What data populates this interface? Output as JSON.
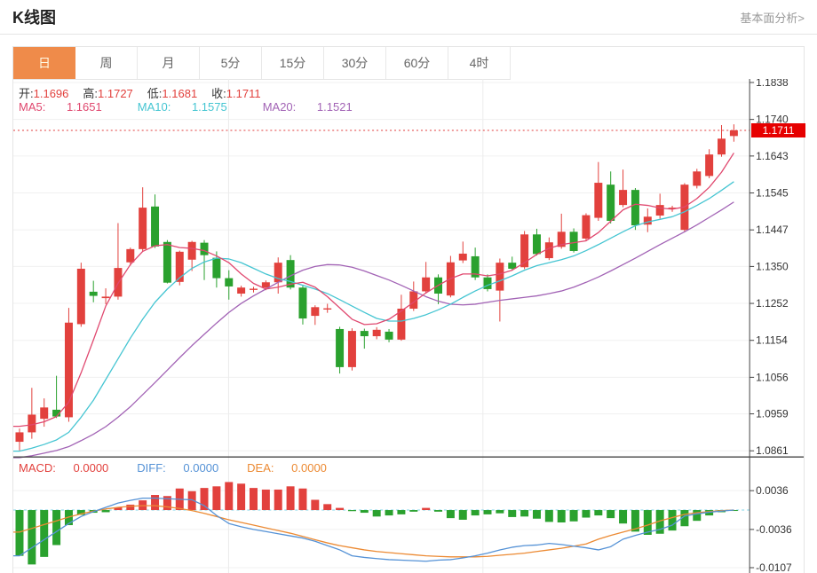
{
  "header": {
    "title": "K线图",
    "link": "基本面分析>"
  },
  "tabs": {
    "items": [
      "日",
      "周",
      "月",
      "5分",
      "15分",
      "30分",
      "60分",
      "4时"
    ],
    "active": "日"
  },
  "legend": {
    "ohlc": [
      {
        "label": "开:",
        "value": "1.1696"
      },
      {
        "label": "高:",
        "value": "1.1727"
      },
      {
        "label": "低:",
        "value": "1.1681"
      },
      {
        "label": "收:",
        "value": "1.1711"
      }
    ],
    "ma": [
      {
        "label": "MA5:",
        "value": "1.1651"
      },
      {
        "label": "MA10:",
        "value": "1.1575"
      },
      {
        "label": "MA20:",
        "value": "1.1521"
      }
    ],
    "macd": [
      {
        "label": "MACD:",
        "value": "0.0000"
      },
      {
        "label": "DIFF:",
        "value": "0.0000"
      },
      {
        "label": "DEA:",
        "value": "0.0000"
      }
    ]
  },
  "price_badge": "1.1711",
  "colors": {
    "up": "#e2413d",
    "down": "#2aa12e",
    "ma5": "#e0486f",
    "ma10": "#45c5d2",
    "ma20": "#a263b5",
    "diff": "#5592d6",
    "dea": "#ec8a33",
    "price_line": "#e03c3c",
    "zero_line": "#7fd4e8",
    "badge": "#e60000",
    "tab_active_bg": "#ef8b4a",
    "grid": "#f0f0f0",
    "vgrid": "#ececec",
    "axis": "#444"
  },
  "chart_data": {
    "type": "candlestick_with_macd",
    "title": "K线图",
    "legend_position": "topleft",
    "grid": true,
    "price_axis": {
      "ticks": [
        1.1838,
        1.174,
        1.1643,
        1.1545,
        1.1447,
        1.135,
        1.1252,
        1.1154,
        1.1056,
        1.0959,
        1.0861
      ],
      "range": [
        1.0838,
        1.1848
      ],
      "last_price": 1.1711
    },
    "macd_axis": {
      "ticks": [
        0.0036,
        -0.0036,
        -0.0107
      ],
      "range": [
        -0.0116,
        0.0093
      ],
      "zero": 0
    },
    "ohlc_current": {
      "open": 1.1696,
      "high": 1.1727,
      "low": 1.1681,
      "close": 1.1711
    },
    "ma_current": {
      "ma5": 1.1651,
      "ma10": 1.1575,
      "ma20": 1.1521
    },
    "macd_current": {
      "macd": 0.0,
      "diff": 0.0,
      "dea": 0.0
    },
    "candles": [
      [
        1.0885,
        1.092,
        1.0862,
        1.091
      ],
      [
        1.091,
        1.1028,
        1.0893,
        1.0957
      ],
      [
        1.0946,
        1.1,
        1.0925,
        1.0976
      ],
      [
        1.097,
        1.106,
        1.0948,
        1.0952
      ],
      [
        1.095,
        1.124,
        1.0938,
        1.1201
      ],
      [
        1.1197,
        1.136,
        1.119,
        1.1344
      ],
      [
        1.1283,
        1.1312,
        1.1255,
        1.1272
      ],
      [
        1.1266,
        1.1292,
        1.125,
        1.127
      ],
      [
        1.127,
        1.1465,
        1.1262,
        1.1346
      ],
      [
        1.1361,
        1.14,
        1.1352,
        1.1396
      ],
      [
        1.1396,
        1.156,
        1.139,
        1.1506
      ],
      [
        1.1509,
        1.1541,
        1.1399,
        1.1403
      ],
      [
        1.1415,
        1.142,
        1.1305,
        1.1307
      ],
      [
        1.1309,
        1.1392,
        1.13,
        1.1389
      ],
      [
        1.1368,
        1.1418,
        1.1338,
        1.1415
      ],
      [
        1.1413,
        1.142,
        1.1314,
        1.138
      ],
      [
        1.1373,
        1.139,
        1.1294,
        1.1319
      ],
      [
        1.1319,
        1.134,
        1.1262,
        1.1297
      ],
      [
        1.1278,
        1.1299,
        1.127,
        1.1294
      ],
      [
        1.1289,
        1.1296,
        1.1281,
        1.1291
      ],
      [
        1.1294,
        1.1313,
        1.1287,
        1.1308
      ],
      [
        1.1308,
        1.1374,
        1.1278,
        1.136
      ],
      [
        1.1367,
        1.138,
        1.1289,
        1.1294
      ],
      [
        1.1294,
        1.1299,
        1.1196,
        1.1212
      ],
      [
        1.1219,
        1.1247,
        1.1195,
        1.1242
      ],
      [
        1.1236,
        1.1251,
        1.1227,
        1.1239
      ],
      [
        1.1184,
        1.119,
        1.1066,
        1.1083
      ],
      [
        1.1083,
        1.1186,
        1.1074,
        1.1179
      ],
      [
        1.1179,
        1.1185,
        1.1132,
        1.1165
      ],
      [
        1.1165,
        1.1189,
        1.1157,
        1.1182
      ],
      [
        1.1177,
        1.1184,
        1.1149,
        1.1156
      ],
      [
        1.1156,
        1.1275,
        1.1153,
        1.1238
      ],
      [
        1.1238,
        1.131,
        1.1232,
        1.1284
      ],
      [
        1.1284,
        1.1362,
        1.1278,
        1.1321
      ],
      [
        1.1321,
        1.1329,
        1.125,
        1.1278
      ],
      [
        1.1273,
        1.1378,
        1.1268,
        1.1361
      ],
      [
        1.1366,
        1.1416,
        1.1359,
        1.1384
      ],
      [
        1.1377,
        1.14,
        1.1314,
        1.1321
      ],
      [
        1.1321,
        1.1329,
        1.1284,
        1.129
      ],
      [
        1.1286,
        1.1371,
        1.1204,
        1.136
      ],
      [
        1.136,
        1.1376,
        1.1339,
        1.1344
      ],
      [
        1.1348,
        1.1444,
        1.1343,
        1.1435
      ],
      [
        1.1435,
        1.145,
        1.1379,
        1.1383
      ],
      [
        1.1372,
        1.1427,
        1.1367,
        1.1414
      ],
      [
        1.1402,
        1.149,
        1.1397,
        1.1442
      ],
      [
        1.1442,
        1.1451,
        1.1387,
        1.1391
      ],
      [
        1.1424,
        1.1491,
        1.1419,
        1.1486
      ],
      [
        1.1479,
        1.1627,
        1.1471,
        1.1572
      ],
      [
        1.1567,
        1.1602,
        1.1464,
        1.1471
      ],
      [
        1.1513,
        1.1607,
        1.1507,
        1.1553
      ],
      [
        1.1553,
        1.1558,
        1.1447,
        1.1459
      ],
      [
        1.1461,
        1.1504,
        1.1441,
        1.1482
      ],
      [
        1.1485,
        1.1543,
        1.1477,
        1.1513
      ],
      [
        1.1504,
        1.1511,
        1.1495,
        1.1506
      ],
      [
        1.1447,
        1.1571,
        1.1442,
        1.1567
      ],
      [
        1.1564,
        1.1609,
        1.1557,
        1.1602
      ],
      [
        1.159,
        1.1661,
        1.1584,
        1.1647
      ],
      [
        1.1647,
        1.1725,
        1.1641,
        1.1689
      ],
      [
        1.1696,
        1.1727,
        1.1681,
        1.1711
      ]
    ],
    "ma5": [
      1.0926,
      1.093,
      1.0938,
      1.0952,
      1.099,
      1.1068,
      1.1155,
      1.1245,
      1.1305,
      1.1355,
      1.139,
      1.1405,
      1.1408,
      1.14,
      1.1398,
      1.1392,
      1.1378,
      1.136,
      1.133,
      1.1305,
      1.129,
      1.1295,
      1.1303,
      1.1308,
      1.1295,
      1.127,
      1.124,
      1.121,
      1.1196,
      1.1198,
      1.121,
      1.1232,
      1.1255,
      1.128,
      1.13,
      1.1318,
      1.133,
      1.133,
      1.1325,
      1.133,
      1.134,
      1.136,
      1.1382,
      1.1398,
      1.1408,
      1.1413,
      1.1418,
      1.144,
      1.147,
      1.15,
      1.1515,
      1.1512,
      1.1505,
      1.1502,
      1.1508,
      1.153,
      1.156,
      1.16,
      1.1651
    ],
    "ma10": [
      1.086,
      1.0868,
      1.0878,
      1.089,
      1.091,
      1.095,
      1.0995,
      1.105,
      1.1105,
      1.116,
      1.121,
      1.1255,
      1.129,
      1.132,
      1.1345,
      1.1362,
      1.1372,
      1.137,
      1.136,
      1.1345,
      1.133,
      1.1318,
      1.131,
      1.13,
      1.129,
      1.1278,
      1.1262,
      1.1245,
      1.1228,
      1.1212,
      1.1205,
      1.1205,
      1.1212,
      1.1222,
      1.1235,
      1.125,
      1.1268,
      1.1285,
      1.13,
      1.1312,
      1.1325,
      1.134,
      1.1352,
      1.136,
      1.1368,
      1.1378,
      1.1392,
      1.1408,
      1.1425,
      1.1442,
      1.1458,
      1.1468,
      1.1475,
      1.1482,
      1.1495,
      1.1512,
      1.153,
      1.1552,
      1.1575
    ],
    "ma20": [
      1.0843,
      1.0848,
      1.0855,
      1.0862,
      1.0872,
      1.0888,
      1.0905,
      1.0925,
      1.095,
      1.0978,
      1.101,
      1.1042,
      1.1075,
      1.1108,
      1.114,
      1.117,
      1.12,
      1.1228,
      1.1252,
      1.1272,
      1.129,
      1.1308,
      1.1325,
      1.134,
      1.135,
      1.1355,
      1.1354,
      1.1348,
      1.1338,
      1.1326,
      1.1314,
      1.13,
      1.1285,
      1.127,
      1.1258,
      1.125,
      1.1248,
      1.125,
      1.1255,
      1.126,
      1.1264,
      1.1268,
      1.1272,
      1.1278,
      1.1285,
      1.1295,
      1.1308,
      1.1322,
      1.1338,
      1.1355,
      1.1372,
      1.139,
      1.1408,
      1.1425,
      1.1442,
      1.146,
      1.148,
      1.15,
      1.1521
    ],
    "macd_hist": [
      -0.0085,
      -0.0101,
      -0.0087,
      -0.0065,
      -0.0028,
      -0.0009,
      -0.0005,
      -0.0004,
      0.0005,
      0.001,
      0.0018,
      0.0028,
      0.0026,
      0.004,
      0.0035,
      0.0041,
      0.0044,
      0.0052,
      0.0049,
      0.0041,
      0.0038,
      0.0038,
      0.0044,
      0.004,
      0.0019,
      0.0011,
      0.0004,
      -0.0002,
      -0.0005,
      -0.0012,
      -0.001,
      -0.0008,
      -0.0003,
      0.0004,
      -0.0003,
      -0.0015,
      -0.0018,
      -0.001,
      -0.0008,
      -0.0006,
      -0.0013,
      -0.0012,
      -0.0016,
      -0.0022,
      -0.0023,
      -0.0021,
      -0.0014,
      -0.001,
      -0.0015,
      -0.0025,
      -0.004,
      -0.0046,
      -0.0044,
      -0.0038,
      -0.003,
      -0.002,
      -0.001,
      -0.0004,
      -5e-05
    ],
    "diff": [
      -0.0085,
      -0.007,
      -0.0055,
      -0.004,
      -0.0025,
      -0.0012,
      -0.0003,
      0.0005,
      0.0013,
      0.0018,
      0.0022,
      0.0022,
      0.0021,
      0.002,
      0.0019,
      0.0008,
      -0.001,
      -0.0025,
      -0.0031,
      -0.0036,
      -0.004,
      -0.0044,
      -0.0048,
      -0.0052,
      -0.0058,
      -0.0066,
      -0.0074,
      -0.0085,
      -0.0088,
      -0.009,
      -0.0092,
      -0.0093,
      -0.0094,
      -0.0095,
      -0.0093,
      -0.0092,
      -0.0089,
      -0.0085,
      -0.008,
      -0.0074,
      -0.0069,
      -0.0066,
      -0.0065,
      -0.0062,
      -0.0064,
      -0.0067,
      -0.007,
      -0.0074,
      -0.0068,
      -0.0054,
      -0.0047,
      -0.0041,
      -0.0036,
      -0.0028,
      -0.0011,
      -0.0007,
      -0.0004,
      -0.0002,
      0.0
    ],
    "dea": [
      -0.0041,
      -0.0034,
      -0.0027,
      -0.002,
      -0.0013,
      -0.0007,
      -0.0002,
      0.0002,
      0.0005,
      0.0007,
      0.0008,
      0.0008,
      0.0006,
      0.0003,
      -0.0001,
      -0.0006,
      -0.0012,
      -0.0018,
      -0.0023,
      -0.0028,
      -0.0033,
      -0.0038,
      -0.0043,
      -0.0049,
      -0.0055,
      -0.0061,
      -0.0066,
      -0.007,
      -0.0074,
      -0.0077,
      -0.0079,
      -0.0081,
      -0.0083,
      -0.0085,
      -0.0086,
      -0.0087,
      -0.0087,
      -0.0087,
      -0.0086,
      -0.0084,
      -0.0082,
      -0.008,
      -0.0077,
      -0.0074,
      -0.0071,
      -0.0067,
      -0.0063,
      -0.0054,
      -0.0047,
      -0.0041,
      -0.0035,
      -0.0028,
      -0.002,
      -0.0014,
      -0.0008,
      -0.0005,
      -0.0003,
      -0.0001,
      0.0
    ]
  }
}
